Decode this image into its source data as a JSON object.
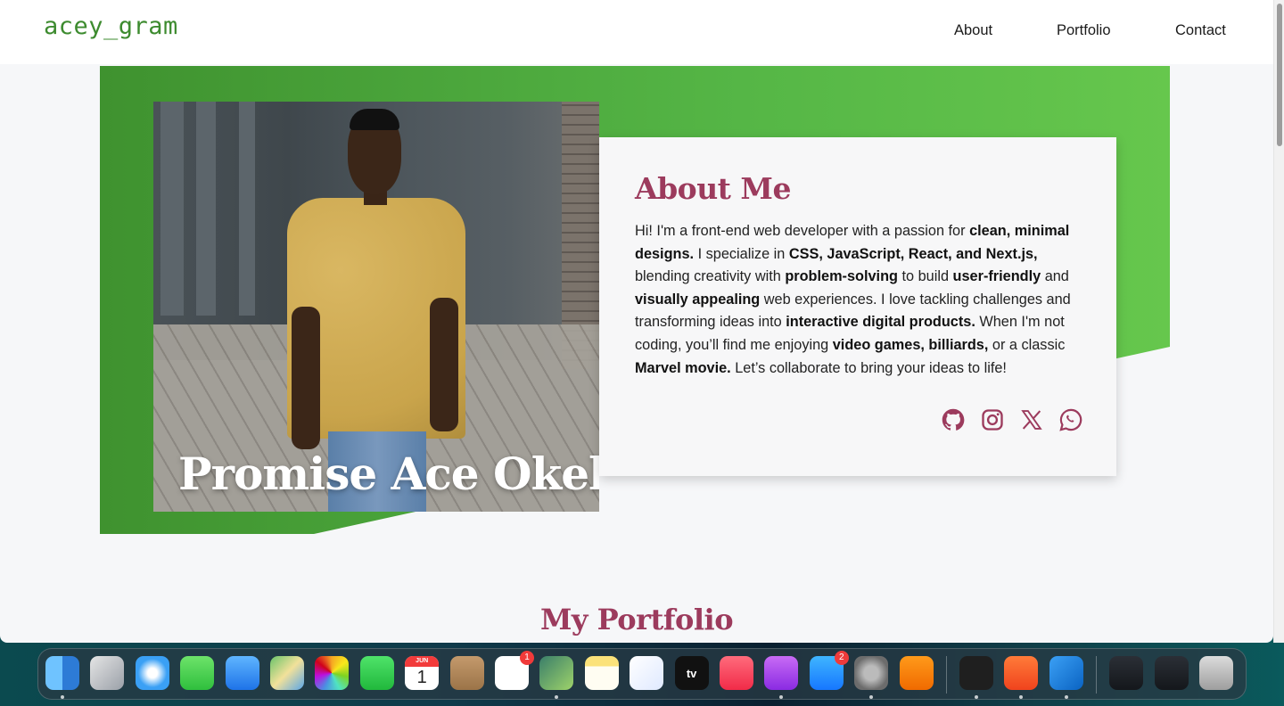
{
  "nav": {
    "logo": "acey_gram",
    "links": [
      "About",
      "Portfolio",
      "Contact"
    ]
  },
  "hero": {
    "name": "Promise Ace Okeke",
    "about_title": "About Me",
    "about_segments": [
      {
        "t": "Hi! I'm a front-end web developer with a passion for ",
        "b": false
      },
      {
        "t": "clean, minimal designs.",
        "b": true
      },
      {
        "t": " I specialize in ",
        "b": false
      },
      {
        "t": "CSS, JavaScript, React, and Next.js,",
        "b": true
      },
      {
        "t": " blending creativity with ",
        "b": false
      },
      {
        "t": "problem-solving",
        "b": true
      },
      {
        "t": " to build ",
        "b": false
      },
      {
        "t": "user-friendly",
        "b": true
      },
      {
        "t": " and ",
        "b": false
      },
      {
        "t": "visually appealing",
        "b": true
      },
      {
        "t": " web experiences. I love tackling challenges and transforming ideas into ",
        "b": false
      },
      {
        "t": "interactive digital products.",
        "b": true
      },
      {
        "t": " When I'm not coding, you’ll find me enjoying ",
        "b": false
      },
      {
        "t": "video games, billiards,",
        "b": true
      },
      {
        "t": " or a classic ",
        "b": false
      },
      {
        "t": "Marvel movie.",
        "b": true
      },
      {
        "t": " Let’s collaborate to bring your ideas to life!",
        "b": false
      }
    ],
    "socials": [
      "github-icon",
      "instagram-icon",
      "x-icon",
      "whatsapp-icon"
    ]
  },
  "portfolio": {
    "title": "My Portfolio"
  },
  "colors": {
    "accent": "#9c3b5d",
    "green": "#4fa83f",
    "logo": "#3d8b2f"
  },
  "dock": {
    "apps": [
      {
        "name": "finder"
      },
      {
        "name": "launchpad"
      },
      {
        "name": "safari"
      },
      {
        "name": "messages"
      },
      {
        "name": "mail"
      },
      {
        "name": "maps"
      },
      {
        "name": "photos"
      },
      {
        "name": "facetime"
      },
      {
        "name": "calendar",
        "month": "JUN",
        "day": "1"
      },
      {
        "name": "contacts"
      },
      {
        "name": "reminders",
        "badge": "1"
      },
      {
        "name": "app-cleaner"
      },
      {
        "name": "notes"
      },
      {
        "name": "freeform"
      },
      {
        "name": "tv",
        "label": "tv"
      },
      {
        "name": "music"
      },
      {
        "name": "podcasts"
      },
      {
        "name": "app-store",
        "badge": "2"
      },
      {
        "name": "system-settings"
      },
      {
        "name": "vlc"
      },
      {
        "name": "terminal"
      },
      {
        "name": "brave"
      },
      {
        "name": "vscode"
      },
      {
        "name": "window-preview-1"
      },
      {
        "name": "window-preview-2"
      },
      {
        "name": "trash"
      }
    ]
  }
}
